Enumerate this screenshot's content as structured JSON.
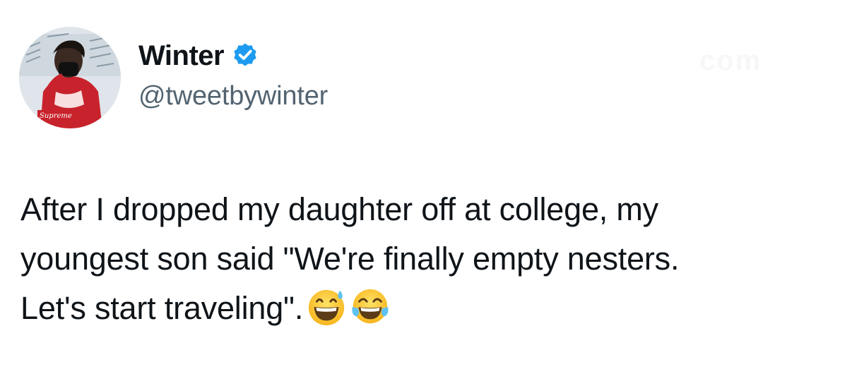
{
  "author": {
    "display_name": "Winter",
    "handle": "@tweetbywinter",
    "verified": true,
    "verified_color": "#1d9bf0",
    "avatar_shirt_text": "Supreme"
  },
  "tweet": {
    "lines": [
      "After I dropped my daughter off at college, my",
      "youngest son said \"We're finally empty nesters.",
      "Let's start traveling\"."
    ],
    "emojis": [
      "grinning-face-with-sweat-emoji",
      "face-with-tears-of-joy-emoji"
    ]
  },
  "watermark": "com",
  "colors": {
    "text_primary": "#0f1419",
    "text_secondary": "#536471",
    "background": "#ffffff"
  }
}
